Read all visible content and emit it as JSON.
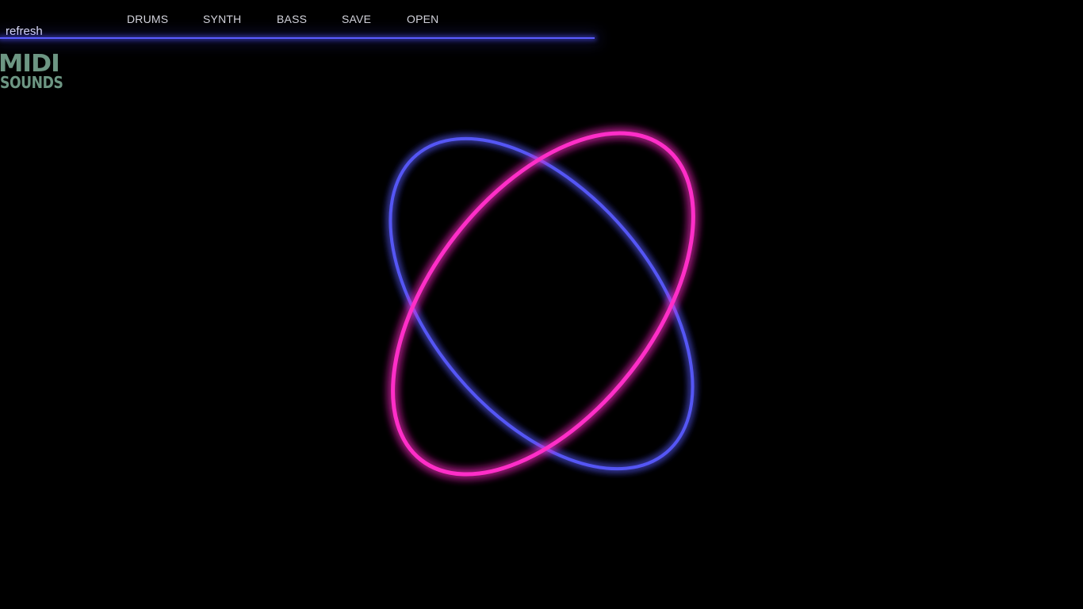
{
  "refresh_label": "refresh",
  "nav": {
    "items": [
      {
        "label": "DRUMS"
      },
      {
        "label": "SYNTH"
      },
      {
        "label": "BASS"
      },
      {
        "label": "SAVE"
      },
      {
        "label": "OPEN"
      }
    ]
  },
  "logo": {
    "line1": "MIDI",
    "line2": "SOUNDS"
  },
  "icons": {
    "orbit_blue": "ellipse-ring-icon",
    "orbit_pink": "ellipse-ring-icon"
  },
  "colors": {
    "background": "#000000",
    "nav_line": "#5a5cff",
    "orbit_blue": "#5557f5",
    "orbit_pink": "#ff2fc8",
    "logo": "#6d9683",
    "nav_text": "#d4d4dc"
  }
}
